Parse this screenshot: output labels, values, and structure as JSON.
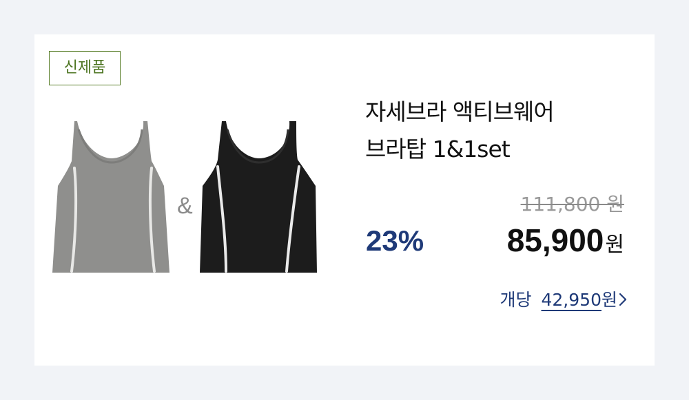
{
  "badge": "신제품",
  "product": {
    "images": [
      {
        "name": "gray-bra-top",
        "color": "#8f8f8d"
      },
      {
        "name": "black-bra-top",
        "color": "#1c1c1c"
      }
    ],
    "connector": "&",
    "title_line1": "자세브라 액티브웨어",
    "title_line2": "브라탑 1&1set"
  },
  "pricing": {
    "original": "111,800 원",
    "discount": "23%",
    "sale_value": "85,900",
    "sale_unit": "원",
    "per_unit_label": "개당",
    "per_unit_value": "42,950",
    "per_unit_unit": "원"
  },
  "colors": {
    "badge_green": "#5a7f2a",
    "accent_navy": "#1f3a78",
    "background": "#f1f3f7"
  }
}
